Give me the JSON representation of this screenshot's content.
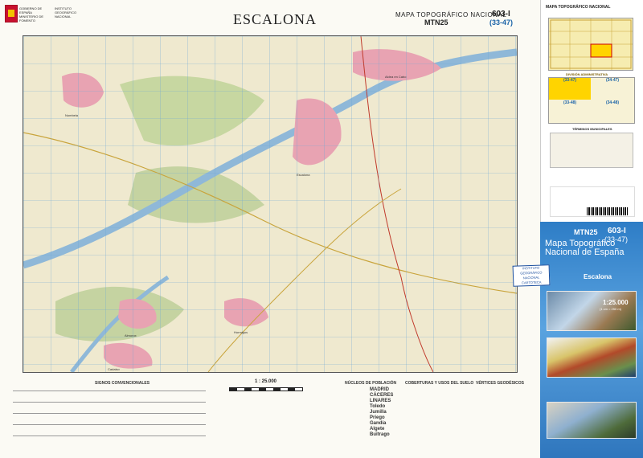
{
  "header": {
    "ministry": "GOBIERNO DE ESPAÑA  MINISTERIO DE FOMENTO",
    "ign": "INSTITUTO GEOGRÁFICO NACIONAL",
    "title": "ESCALONA",
    "subtitle": "MAPA TOPOGRÁFICO NACIONAL",
    "series": "MTN25",
    "sheet_number": "603-I",
    "sheet_code": "(33-47)"
  },
  "map": {
    "labels": [
      "Escalona",
      "Nombela",
      "Hormigos",
      "Aldea en Cabo",
      "Almorox",
      "Cadalso"
    ],
    "colors": {
      "land": "#efe9cf",
      "water": "#8fb8d8",
      "urban": "#e8a3b2",
      "veg": "#9fc07a",
      "grid": "#6aa7d6"
    }
  },
  "legend": {
    "signs_title": "SIGNOS CONVENCIONALES",
    "scale": "1 : 25.000",
    "towns_title": "NÚCLEOS DE POBLACIÓN",
    "cover_title": "COBERTURAS Y USOS DEL SUELO",
    "vertices_title": "VÉRTICES GEODÉSICOS",
    "places": [
      "MADRID",
      "CÁCERES",
      "LINARES",
      "Toledo",
      "Jumilla",
      "Priego",
      "Gandía",
      "Algete",
      "Buitrago"
    ]
  },
  "cover": {
    "index_title": "MAPA TOPOGRÁFICO NACIONAL",
    "admin_title": "DIVISIÓN ADMINISTRATIVA",
    "quadrants": [
      "(33-47)",
      "(34-47)",
      "(33-48)",
      "(34-48)"
    ],
    "municipal_title": "TÉRMINOS MUNICIPALES",
    "series": "MTN25",
    "sheet_number": "603-I",
    "sheet_code": "(33-47)",
    "product_title": "Mapa Topográfico Nacional de España",
    "name": "Escalona",
    "stamp": [
      "INSTITUTO GEOGRÁFICO",
      "NACIONAL",
      "CARTOTECA"
    ],
    "ratio": "1:25.000",
    "ratio_sub": "(1 cm = 250 m)"
  }
}
